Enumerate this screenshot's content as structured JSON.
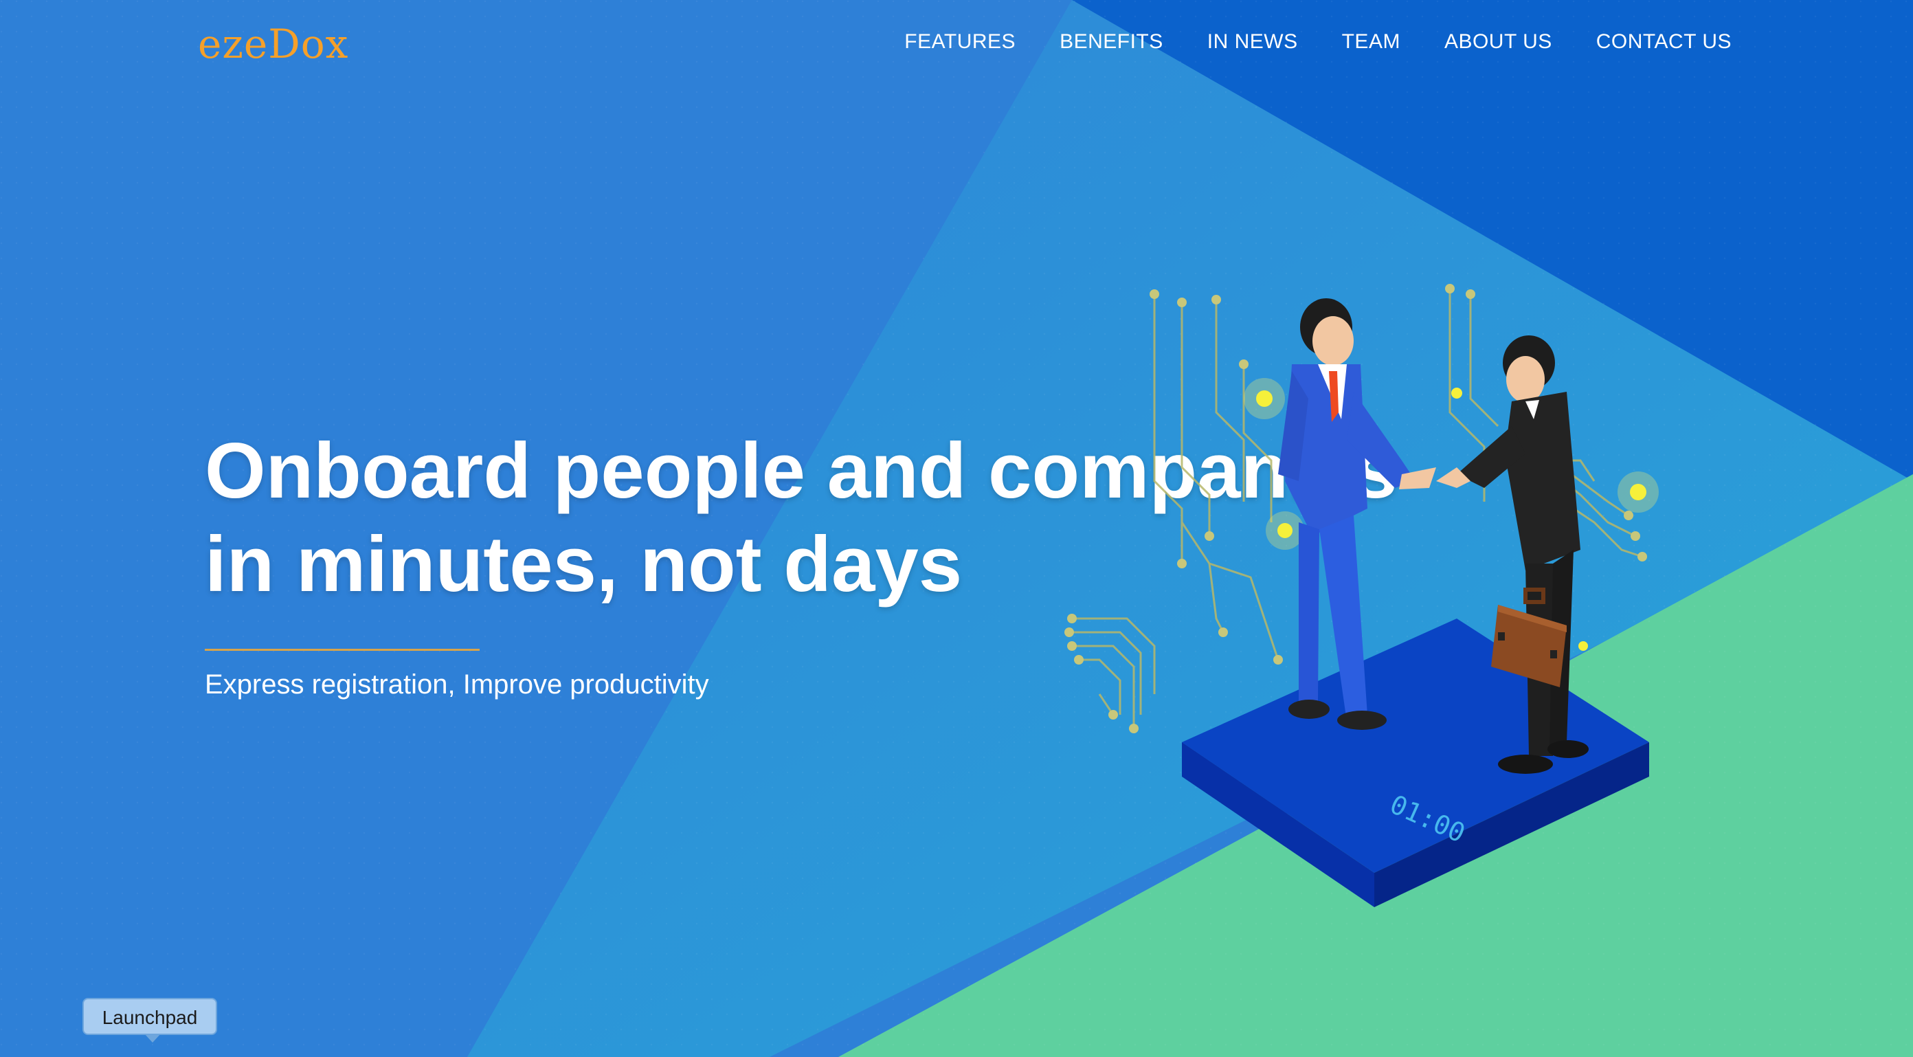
{
  "header": {
    "logo_text": "ezeDox",
    "nav": [
      {
        "label": "FEATURES"
      },
      {
        "label": "BENEFITS"
      },
      {
        "label": "IN NEWS"
      },
      {
        "label": "TEAM"
      },
      {
        "label": "ABOUT US"
      },
      {
        "label": "CONTACT US"
      }
    ]
  },
  "hero": {
    "title_line1": "Onboard people and companies",
    "title_line2": "in minutes, not days",
    "subtitle": "Express registration, Improve productivity",
    "illustration": {
      "icon": "business-handshake-illustration",
      "platform_display": "01:00"
    }
  },
  "dock": {
    "launchpad_tooltip": "Launchpad"
  },
  "colors": {
    "background_blue": "#2e7fd6",
    "dark_blue_band": "#0a5fc9",
    "teal_band": "#2bb3d6",
    "green_band": "#5fd09d",
    "logo_orange": "#f5a02a",
    "divider_gold": "#d8a44a"
  }
}
